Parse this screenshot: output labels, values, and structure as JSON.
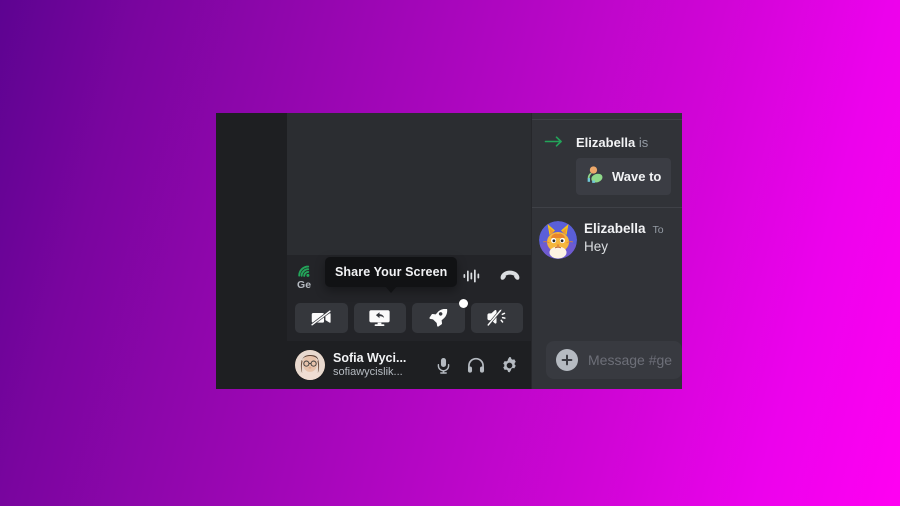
{
  "background": {
    "gradient_from": "#5d0391",
    "gradient_to": "#ff00f2"
  },
  "colors": {
    "accent_green": "#23a55a",
    "panel_dark": "#1e1f22",
    "panel_mid": "#2b2d31",
    "panel_chat": "#313338",
    "button_bg": "#35373c",
    "tooltip_bg": "#111214",
    "text_primary": "#f2f3f5",
    "text_muted": "#949ba4"
  },
  "voice_panel": {
    "signal_icon": "signal-strength-icon",
    "channel_name": "Ge",
    "channel_name_full": "General",
    "right_icons": [
      {
        "name": "soundboard-icon",
        "label": "Soundboard"
      },
      {
        "name": "disconnect-call-icon",
        "label": "Disconnect"
      }
    ],
    "actions": [
      {
        "name": "camera-off-button",
        "icon": "video-camera-off-icon",
        "label": "Turn On Camera",
        "badge": false
      },
      {
        "name": "screen-share-button",
        "icon": "screen-share-icon",
        "label": "Share Your Screen",
        "badge": false
      },
      {
        "name": "activities-button",
        "icon": "rocket-icon",
        "label": "Start an Activity",
        "badge": true
      },
      {
        "name": "soundboard-button",
        "icon": "soundboard-speaker-icon",
        "label": "Soundboard",
        "badge": false
      }
    ]
  },
  "tooltip": {
    "text": "Share Your Screen"
  },
  "user_panel": {
    "display_name": "Sofia Wyci...",
    "handle": "sofiawycislik...",
    "avatar": "user-photo-avatar",
    "controls": [
      {
        "name": "microphone-button",
        "icon": "microphone-icon",
        "label": "Mute"
      },
      {
        "name": "headphones-button",
        "icon": "headphones-icon",
        "label": "Deafen"
      },
      {
        "name": "settings-button",
        "icon": "gear-icon",
        "label": "User Settings"
      }
    ]
  },
  "chat": {
    "system_message": {
      "arrow_icon": "arrow-right-icon",
      "author": "Elizabella",
      "rest": " is",
      "wave_button": {
        "emoji": "👋",
        "label": "Wave to"
      }
    },
    "message": {
      "avatar": "cat-character-avatar",
      "author": "Elizabella",
      "timestamp": "To",
      "text": "Hey"
    },
    "input": {
      "attach_icon": "plus-circle-icon",
      "placeholder": "Message #ge"
    }
  }
}
